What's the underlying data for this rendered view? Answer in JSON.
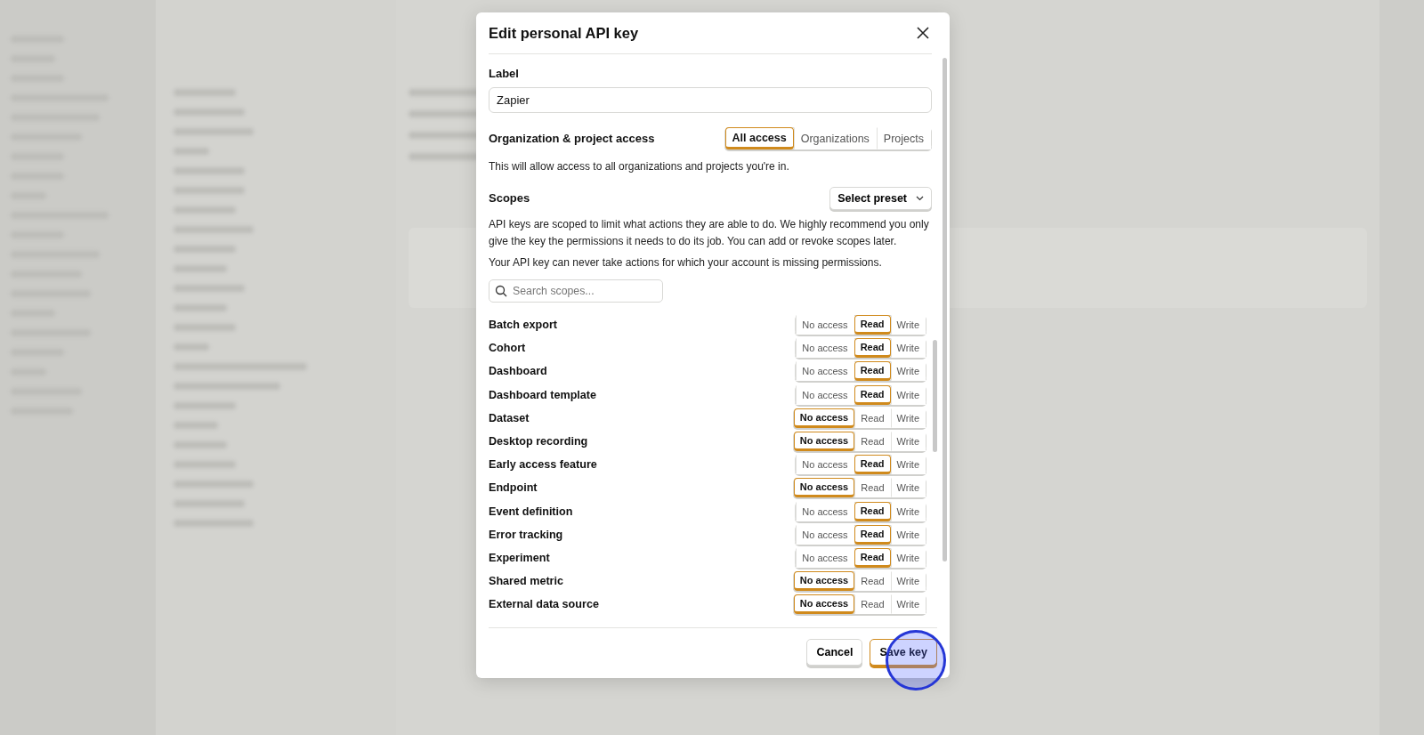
{
  "dialog": {
    "title": "Edit personal API key",
    "label_field": {
      "label": "Label",
      "value": "Zapier"
    },
    "access": {
      "label": "Organization & project access",
      "options": [
        {
          "label": "All access",
          "selected": true
        },
        {
          "label": "Organizations",
          "selected": false
        },
        {
          "label": "Projects",
          "selected": false
        }
      ],
      "description": "This will allow access to all organizations and projects you're in."
    },
    "scopes": {
      "label": "Scopes",
      "preset_button": "Select preset",
      "description": "API keys are scoped to limit what actions they are able to do. We highly recommend you only give the key the permissions it needs to do its job. You can add or revoke scopes later.",
      "note": "Your API key can never take actions for which your account is missing permissions.",
      "search": {
        "placeholder": "Search scopes..."
      },
      "items": [
        {
          "name": "Batch export",
          "options": [
            {
              "label": "No access",
              "selected": false
            },
            {
              "label": "Read",
              "selected": true
            },
            {
              "label": "Write",
              "selected": false
            }
          ]
        },
        {
          "name": "Cohort",
          "options": [
            {
              "label": "No access",
              "selected": false
            },
            {
              "label": "Read",
              "selected": true
            },
            {
              "label": "Write",
              "selected": false
            }
          ]
        },
        {
          "name": "Dashboard",
          "options": [
            {
              "label": "No access",
              "selected": false
            },
            {
              "label": "Read",
              "selected": true
            },
            {
              "label": "Write",
              "selected": false
            }
          ]
        },
        {
          "name": "Dashboard template",
          "options": [
            {
              "label": "No access",
              "selected": false
            },
            {
              "label": "Read",
              "selected": true
            },
            {
              "label": "Write",
              "selected": false
            }
          ]
        },
        {
          "name": "Dataset",
          "options": [
            {
              "label": "No access",
              "selected": true
            },
            {
              "label": "Read",
              "selected": false
            },
            {
              "label": "Write",
              "selected": false
            }
          ]
        },
        {
          "name": "Desktop recording",
          "options": [
            {
              "label": "No access",
              "selected": true
            },
            {
              "label": "Read",
              "selected": false
            },
            {
              "label": "Write",
              "selected": false
            }
          ]
        },
        {
          "name": "Early access feature",
          "options": [
            {
              "label": "No access",
              "selected": false
            },
            {
              "label": "Read",
              "selected": true
            },
            {
              "label": "Write",
              "selected": false
            }
          ]
        },
        {
          "name": "Endpoint",
          "options": [
            {
              "label": "No access",
              "selected": true
            },
            {
              "label": "Read",
              "selected": false
            },
            {
              "label": "Write",
              "selected": false
            }
          ]
        },
        {
          "name": "Event definition",
          "options": [
            {
              "label": "No access",
              "selected": false
            },
            {
              "label": "Read",
              "selected": true
            },
            {
              "label": "Write",
              "selected": false
            }
          ]
        },
        {
          "name": "Error tracking",
          "options": [
            {
              "label": "No access",
              "selected": false
            },
            {
              "label": "Read",
              "selected": true
            },
            {
              "label": "Write",
              "selected": false
            }
          ]
        },
        {
          "name": "Experiment",
          "options": [
            {
              "label": "No access",
              "selected": false
            },
            {
              "label": "Read",
              "selected": true
            },
            {
              "label": "Write",
              "selected": false
            }
          ]
        },
        {
          "name": "Shared metric",
          "options": [
            {
              "label": "No access",
              "selected": true
            },
            {
              "label": "Read",
              "selected": false
            },
            {
              "label": "Write",
              "selected": false
            }
          ]
        },
        {
          "name": "External data source",
          "options": [
            {
              "label": "No access",
              "selected": true
            },
            {
              "label": "Read",
              "selected": false
            },
            {
              "label": "Write",
              "selected": false
            }
          ]
        }
      ]
    },
    "buttons": [
      {
        "label": "Cancel",
        "kind": "secondary"
      },
      {
        "label": "Save key",
        "kind": "primary"
      }
    ]
  }
}
